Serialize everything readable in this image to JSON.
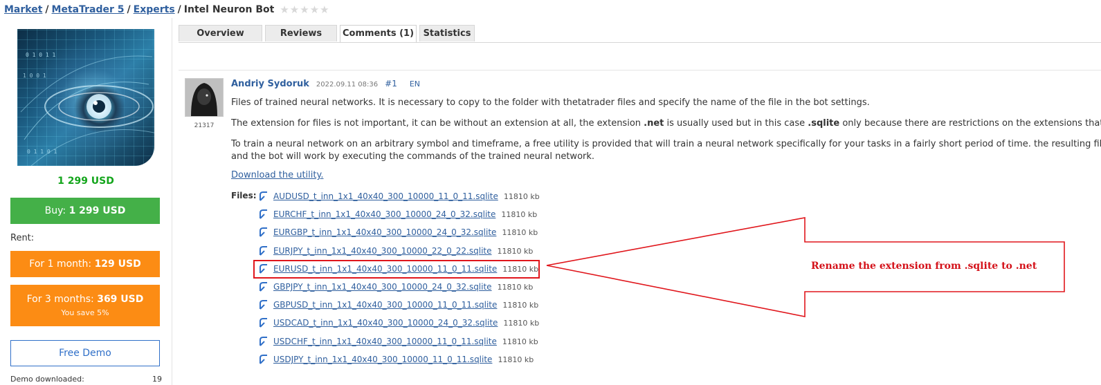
{
  "breadcrumb": {
    "items": [
      "Market",
      "MetaTrader 5",
      "Experts"
    ],
    "current": "Intel Neuron Bot",
    "separator": "/",
    "rating_stars": "★★★★★"
  },
  "product": {
    "price": "1 299 USD",
    "buy_label": "Buy: ",
    "buy_price": "1 299 USD",
    "rent_label": "Rent:",
    "rent_1_label": "For 1 month: ",
    "rent_1_price": "129 USD",
    "rent_3_label": "For 3 months: ",
    "rent_3_price": "369 USD",
    "rent_3_save": "You save 5%",
    "demo_label": "Free Demo",
    "demo_downloaded_label": "Demo downloaded:",
    "demo_downloaded_count": "19"
  },
  "tabs": [
    {
      "label": "Overview",
      "active": false
    },
    {
      "label": "Reviews",
      "active": false
    },
    {
      "label": "Comments (1)",
      "active": true
    },
    {
      "label": "Statistics",
      "active": false
    }
  ],
  "comment": {
    "author": "Andriy Sydoruk",
    "date": "2022.09.11 08:36",
    "number": "#1",
    "lang": "EN",
    "rating": "21317",
    "para1": "Files of trained neural networks. It is necessary to copy to the folder with thetatrader files and specify the name of the file in the bot settings.",
    "para2_a": "The extension for files is not important, it can be without an extension at all, the extension ",
    "para2_b": ".net",
    "para2_c": " is usually used but in this case ",
    "para2_d": ".sqlite",
    "para2_e": " only because there are restrictions on the extensions that ca",
    "para3_line1": "To train a neural network on an arbitrary symbol and timeframe, a free utility is provided that will train a neural network specifically for your tasks in a fairly short period of time. the resulting file mu",
    "para3_line2": "and the bot will work by executing the commands of the trained neural network.",
    "download_link": "Download the utility.",
    "files_label": "Files:",
    "files": [
      {
        "name": "AUDUSD_t_inn_1x1_40x40_300_10000_11_0_11.sqlite",
        "size": "11810 kb"
      },
      {
        "name": "EURCHF_t_inn_1x1_40x40_300_10000_24_0_32.sqlite",
        "size": "11810 kb"
      },
      {
        "name": "EURGBP_t_inn_1x1_40x40_300_10000_24_0_32.sqlite",
        "size": "11810 kb"
      },
      {
        "name": "EURJPY_t_inn_1x1_40x40_300_10000_22_0_22.sqlite",
        "size": "11810 kb"
      },
      {
        "name": "EURUSD_t_inn_1x1_40x40_300_10000_11_0_11.sqlite",
        "size": "11810 kb"
      },
      {
        "name": "GBPJPY_t_inn_1x1_40x40_300_10000_24_0_32.sqlite",
        "size": "11810 kb"
      },
      {
        "name": "GBPUSD_t_inn_1x1_40x40_300_10000_11_0_11.sqlite",
        "size": "11810 kb"
      },
      {
        "name": "USDCAD_t_inn_1x1_40x40_300_10000_24_0_32.sqlite",
        "size": "11810 kb"
      },
      {
        "name": "USDCHF_t_inn_1x1_40x40_300_10000_11_0_11.sqlite",
        "size": "11810 kb"
      },
      {
        "name": "USDJPY_t_inn_1x1_40x40_300_10000_11_0_11.sqlite",
        "size": "11810 kb"
      }
    ]
  },
  "annotation": {
    "text": "Rename the extension from .sqlite to .net",
    "color": "#d4121a"
  },
  "colors": {
    "link": "#2f5f9e",
    "buy": "#44b048",
    "rent": "#fc8c14",
    "price": "#13a51b",
    "demo_border": "#2f6fc8"
  }
}
